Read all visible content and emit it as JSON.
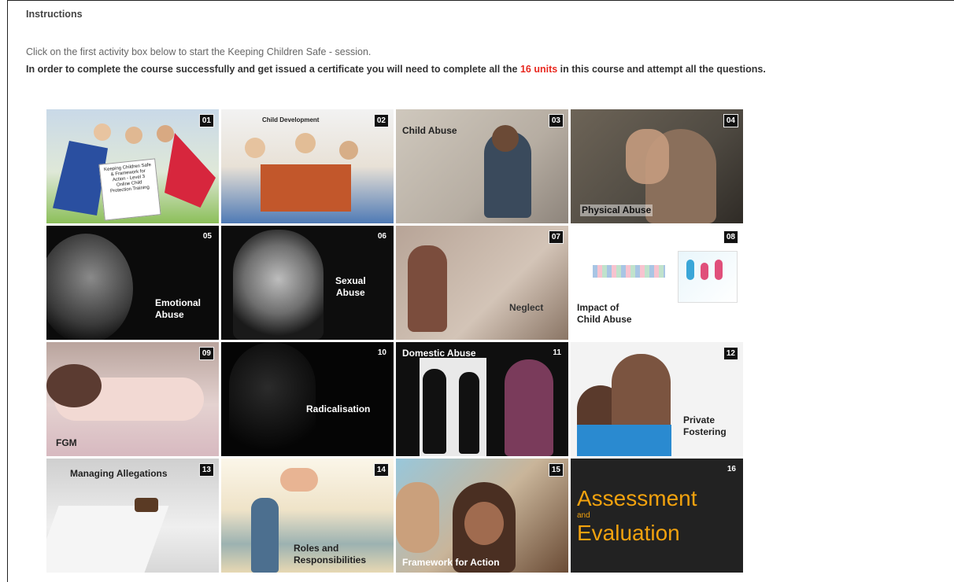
{
  "instructions": {
    "heading": "Instructions",
    "line1": "Click on the first activity box below to start the Keeping Children Safe - session.",
    "line2_before": "In order to complete the course successfully and get issued a certificate you will need to complete all the ",
    "line2_highlight": "16 units",
    "line2_after": " in this course and attempt all the questions.",
    "highlight_color": "#e8281f"
  },
  "tiles": [
    {
      "number": "01",
      "label": "Keeping Children Safe\n& Framework for\nAction - Level 3\nOnline Child\nProtection Training"
    },
    {
      "number": "02",
      "label": "Child Development"
    },
    {
      "number": "03",
      "label": "Child Abuse"
    },
    {
      "number": "04",
      "label": "Physical Abuse"
    },
    {
      "number": "05",
      "label": "Emotional\nAbuse"
    },
    {
      "number": "06",
      "label": "Sexual\nAbuse"
    },
    {
      "number": "07",
      "label": "Neglect"
    },
    {
      "number": "08",
      "label": "Impact of\nChild Abuse"
    },
    {
      "number": "09",
      "label": "FGM"
    },
    {
      "number": "10",
      "label": "Radicalisation"
    },
    {
      "number": "11",
      "label": "Domestic Abuse"
    },
    {
      "number": "12",
      "label": "Private\nFostering"
    },
    {
      "number": "13",
      "label": "Managing Allegations"
    },
    {
      "number": "14",
      "label": "Roles and\nResponsibilities"
    },
    {
      "number": "15",
      "label": "Framework for Action"
    },
    {
      "number": "16",
      "label_line1": "Assessment",
      "label_line2": "and",
      "label_line3": "Evaluation"
    }
  ],
  "colors": {
    "accent_orange": "#f2a20e",
    "badge_bg": "#111111"
  }
}
